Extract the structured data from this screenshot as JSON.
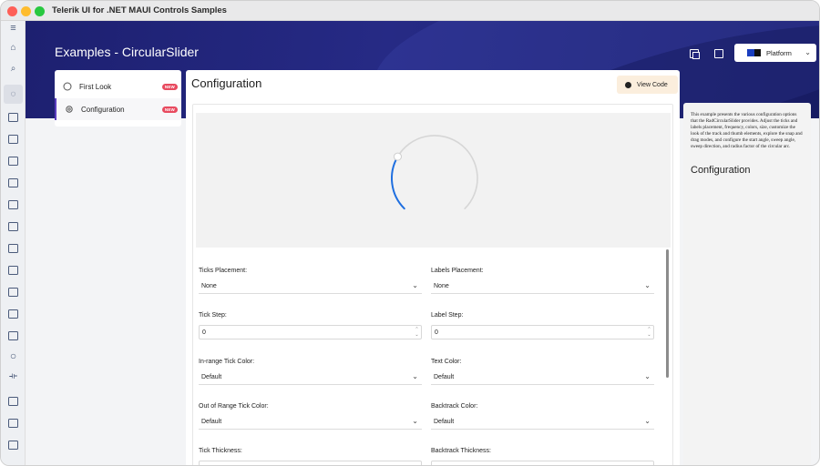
{
  "window": {
    "title": "Telerik UI for .NET MAUI Controls Samples"
  },
  "header": {
    "title": "Examples - CircularSlider",
    "platform_label": "Platform"
  },
  "nav": {
    "items": [
      {
        "label": "First Look",
        "badge": "NEW",
        "icon": "circular-slider-icon"
      },
      {
        "label": "Configuration",
        "badge": "NEW",
        "icon": "gear-icon"
      }
    ]
  },
  "main": {
    "title": "Configuration",
    "view_code_label": "View Code",
    "slider": {
      "value_fraction": 0.28,
      "track_color": "#d6d6d6",
      "range_color": "#1f6fe0"
    },
    "fields": [
      {
        "label": "Ticks Placement:",
        "value": "None",
        "kind": "select"
      },
      {
        "label": "Labels Placement:",
        "value": "None",
        "kind": "select"
      },
      {
        "label": "Tick Step:",
        "value": "0",
        "kind": "number"
      },
      {
        "label": "Label Step:",
        "value": "0",
        "kind": "number"
      },
      {
        "label": "In-range Tick Color:",
        "value": "Default",
        "kind": "select"
      },
      {
        "label": "Text Color:",
        "value": "Default",
        "kind": "select"
      },
      {
        "label": "Out of Range Tick Color:",
        "value": "Default",
        "kind": "select"
      },
      {
        "label": "Backtrack Color:",
        "value": "Default",
        "kind": "select"
      },
      {
        "label": "Tick Thickness:",
        "value": "",
        "kind": "number"
      },
      {
        "label": "Backtrack Thickness:",
        "value": "",
        "kind": "number"
      }
    ]
  },
  "description": {
    "text": "This example presents the various configuration options that the RadCircularSlider provides. Adjust the ticks and labels placement, frequency, colors, size, customize the look of the track and thumb elements, explore the snap and drag modes, and configure the start angle, sweep angle, sweep direction, and radius factor of the circular arc.",
    "heading": "Configuration"
  },
  "colors": {
    "hero": "#22267e",
    "accent": "#5a3dbf",
    "badge": "#e84a5f"
  }
}
